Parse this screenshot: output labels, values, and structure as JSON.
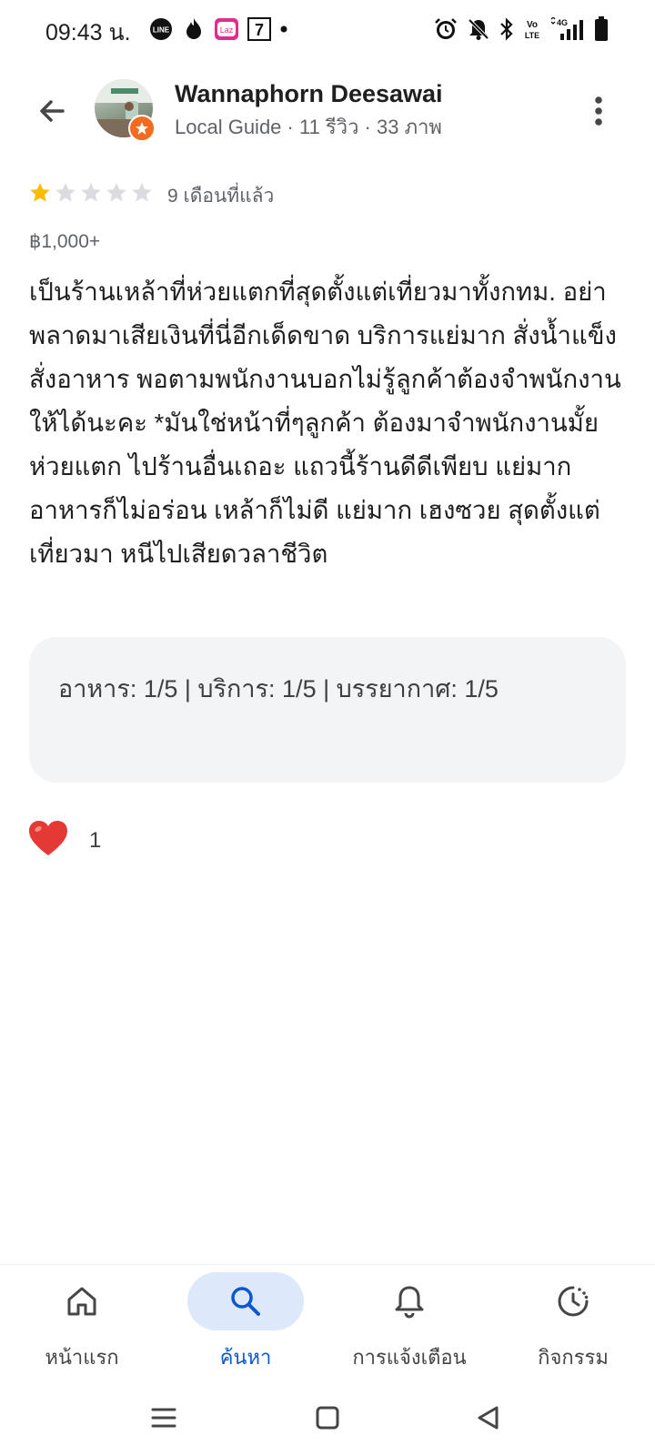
{
  "status_bar": {
    "time": "09:43 น.",
    "icons": [
      "line-icon",
      "flame-icon",
      "lazada-icon",
      "seven-eleven-icon",
      "dot-icon",
      "alarm-icon",
      "mute-icon",
      "bluetooth-icon",
      "volte-icon",
      "signal-icon",
      "battery-icon"
    ]
  },
  "header": {
    "name": "Wannaphorn Deesawai",
    "meta": "Local Guide · 11 รีวิว · 33 ภาพ"
  },
  "review": {
    "rating": 1,
    "max_rating": 5,
    "date": "9 เดือนที่แล้ว",
    "price": "฿1,000+",
    "text": "เป็นร้านเหล้าที่ห่วยแตกที่สุดตั้งแต่เที่ยวมาทั้งกทม. อย่าพลาดมาเสียเงินที่นี่อีกเด็ดขาด บริการแย่มาก สั่งน้ำแข็ง สั่งอาหาร พอตามพนักงานบอกไม่รู้ลูกค้าต้องจำพนักงานให้ได้นะคะ *มันใช่หน้าที่ๆลูกค้า ต้องมาจำพนักงานมั้ย ห่วยแตก ไปร้านอื่นเถอะ แถวนี้ร้านดีดีเพียบ แย่มาก อาหารก็ไม่อร่อน เหล้าก็ไม่ดี แย่มาก เฮงซวย สุดตั้งแต่เที่ยวมา หนีไปเสียดวลาชีวิต",
    "sub_ratings": "อาหาร: 1/5  |  บริการ: 1/5  |  บรรยากาศ: 1/5",
    "likes": "1"
  },
  "bottom_nav": {
    "items": [
      {
        "label": "หน้าแรก",
        "icon": "home-icon",
        "active": false
      },
      {
        "label": "ค้นหา",
        "icon": "search-icon",
        "active": true
      },
      {
        "label": "การแจ้งเตือน",
        "icon": "bell-icon",
        "active": false
      },
      {
        "label": "กิจกรรม",
        "icon": "activity-icon",
        "active": false
      }
    ]
  },
  "colors": {
    "star_filled": "#fbbc04",
    "star_empty": "#dadce0",
    "accent": "#0b57d0",
    "active_pill": "#dde8fb",
    "card_bg": "#f3f4f6",
    "heart": "#e53935"
  }
}
